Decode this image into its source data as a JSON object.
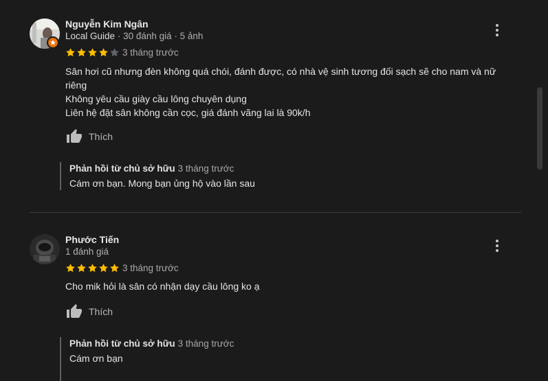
{
  "reviews": [
    {
      "name": "Nguyễn Kim Ngân",
      "local_guide": "Local Guide",
      "sep1": " · ",
      "review_count": "30 đánh giá",
      "sep2": " · ",
      "photo_count": "5 ảnh",
      "rating": 4,
      "time": "3 tháng trước",
      "text_lines": [
        "Sân hơi cũ nhưng đèn không quá chói, đánh được, có nhà vệ sinh tương đối sạch sẽ cho nam và nữ",
        "riêng",
        "Không yêu cầu giày cầu lông chuyên dụng",
        "Liên hệ đặt sân không cần cọc, giá đánh vãng lai là 90k/h"
      ],
      "like_label": "Thích",
      "reply": {
        "owner_label": "Phản hồi từ chủ sở hữu",
        "time": "3 tháng trước",
        "text": "Cám ơn bạn. Mong bạn ủng hộ vào lần sau"
      }
    },
    {
      "name": "Phước Tiến",
      "review_count": "1 đánh giá",
      "rating": 5,
      "time": "3 tháng trước",
      "text_lines": [
        "Cho mik hỏi là sân có nhận dạy cầu lông ko ạ"
      ],
      "like_label": "Thích",
      "reply": {
        "owner_label": "Phản hồi từ chủ sở hữu",
        "time": "3 tháng trước",
        "text": "Cám ơn bạn"
      }
    }
  ],
  "colors": {
    "background": "#1b1b1b",
    "star_filled": "#fbbc04",
    "star_empty": "#5f6368",
    "local_guide_badge": "#e8710a"
  },
  "icons": {
    "more": "more-vert-icon",
    "like": "thumb-up-icon",
    "star": "star-icon"
  }
}
